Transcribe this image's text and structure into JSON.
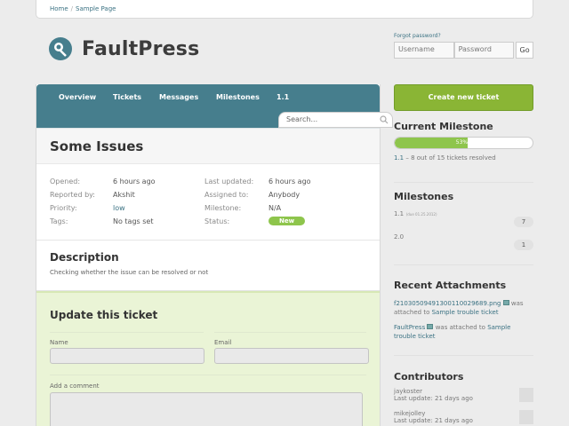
{
  "breadcrumb": {
    "home": "Home",
    "separator": "/",
    "current": "Sample Page"
  },
  "brand": {
    "name": "FaultPress",
    "logo": "fault-logo-icon"
  },
  "login": {
    "forgot": "Forgot password?",
    "username_placeholder": "Username",
    "password_placeholder": "Password",
    "go": "Go"
  },
  "nav": {
    "tabs": [
      "Overview",
      "Tickets",
      "Messages",
      "Milestones",
      "1.1"
    ],
    "search_placeholder": "Search..."
  },
  "ticket": {
    "title": "Some Issues",
    "props": {
      "opened_label": "Opened:",
      "opened": "6 hours ago",
      "reported_label": "Reported by:",
      "reported": "Akshit",
      "priority_label": "Priority:",
      "priority": "low",
      "tags_label": "Tags:",
      "tags": "No tags set",
      "updated_label": "Last updated:",
      "updated": "6 hours ago",
      "assigned_label": "Assigned to:",
      "assigned": "Anybody",
      "milestone_label": "Milestone:",
      "milestone": "N/A",
      "status_label": "Status:",
      "status": "New"
    },
    "description_heading": "Description",
    "description": "Checking whether the issue can be resolved or not"
  },
  "update": {
    "heading": "Update this ticket",
    "name_label": "Name",
    "email_label": "Email",
    "comment_label": "Add a comment"
  },
  "sidebar": {
    "create": "Create new ticket",
    "current_milestone": {
      "heading": "Current Milestone",
      "progress_text": "53%",
      "progress": 0.53,
      "version": "1.1",
      "summary": "– 8 out of 15 tickets resolved"
    },
    "milestones": {
      "heading": "Milestones",
      "items": [
        {
          "name": "1.1",
          "due": "(due 01.25.2012)",
          "count": "7"
        },
        {
          "name": "2.0",
          "due": "",
          "count": "1"
        }
      ]
    },
    "attachments": {
      "heading": "Recent Attachments",
      "items": [
        {
          "file": "f2103050949130011002​9689.png",
          "mid": "was attached to",
          "target": "Sample trouble ticket"
        },
        {
          "file": "FaultPress",
          "mid": "was attached to",
          "target": "Sample trouble ticket"
        }
      ]
    },
    "contributors": {
      "heading": "Contributors",
      "items": [
        {
          "name": "jaykoster",
          "update": "Last update: 21 days ago"
        },
        {
          "name": "mikejolley",
          "update": "Last update: 21 days ago"
        }
      ]
    }
  },
  "colors": {
    "nav": "#467e8d",
    "accent": "#8ab535",
    "status_new": "#8ec54c",
    "update_bg": "#eaf4d6"
  }
}
